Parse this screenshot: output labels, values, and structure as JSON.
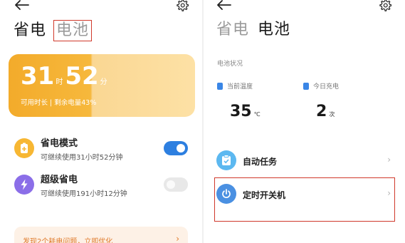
{
  "left": {
    "tabs": [
      {
        "label": "省电"
      },
      {
        "label": "电池"
      }
    ],
    "hero": {
      "hours": "31",
      "hours_unit": "时",
      "minutes": "52",
      "minutes_unit": "分",
      "subtitle": "可用时长 | 剩余电量43%",
      "battery_percent": 43
    },
    "modes": [
      {
        "title": "省电模式",
        "subtitle": "可继续使用31小时52分钟",
        "enabled": true,
        "icon": "battery-plus-icon"
      },
      {
        "title": "超级省电",
        "subtitle": "可继续使用191小时12分钟",
        "enabled": false,
        "icon": "lightning-icon"
      }
    ],
    "promo": {
      "text": "发现2个耗电问题，立即优化",
      "arrow": "›"
    }
  },
  "right": {
    "tabs": [
      {
        "label": "省电"
      },
      {
        "label": "电池"
      }
    ],
    "section_label": "电池状况",
    "stats": [
      {
        "label": "当前温度",
        "value": "35",
        "unit": "℃",
        "icon": "thermometer-icon"
      },
      {
        "label": "今日充电",
        "value": "2",
        "unit": "次",
        "icon": "battery-icon"
      }
    ],
    "items": [
      {
        "label": "自动任务",
        "chevron": "›",
        "icon": "task-check-icon"
      },
      {
        "label": "定时开关机",
        "chevron": "›",
        "icon": "power-icon"
      }
    ]
  },
  "colors": {
    "accent_orange": "#f3ab2b",
    "accent_blue": "#2d7fe0",
    "highlight_red": "#d0392b",
    "purple": "#8b6ee8"
  }
}
